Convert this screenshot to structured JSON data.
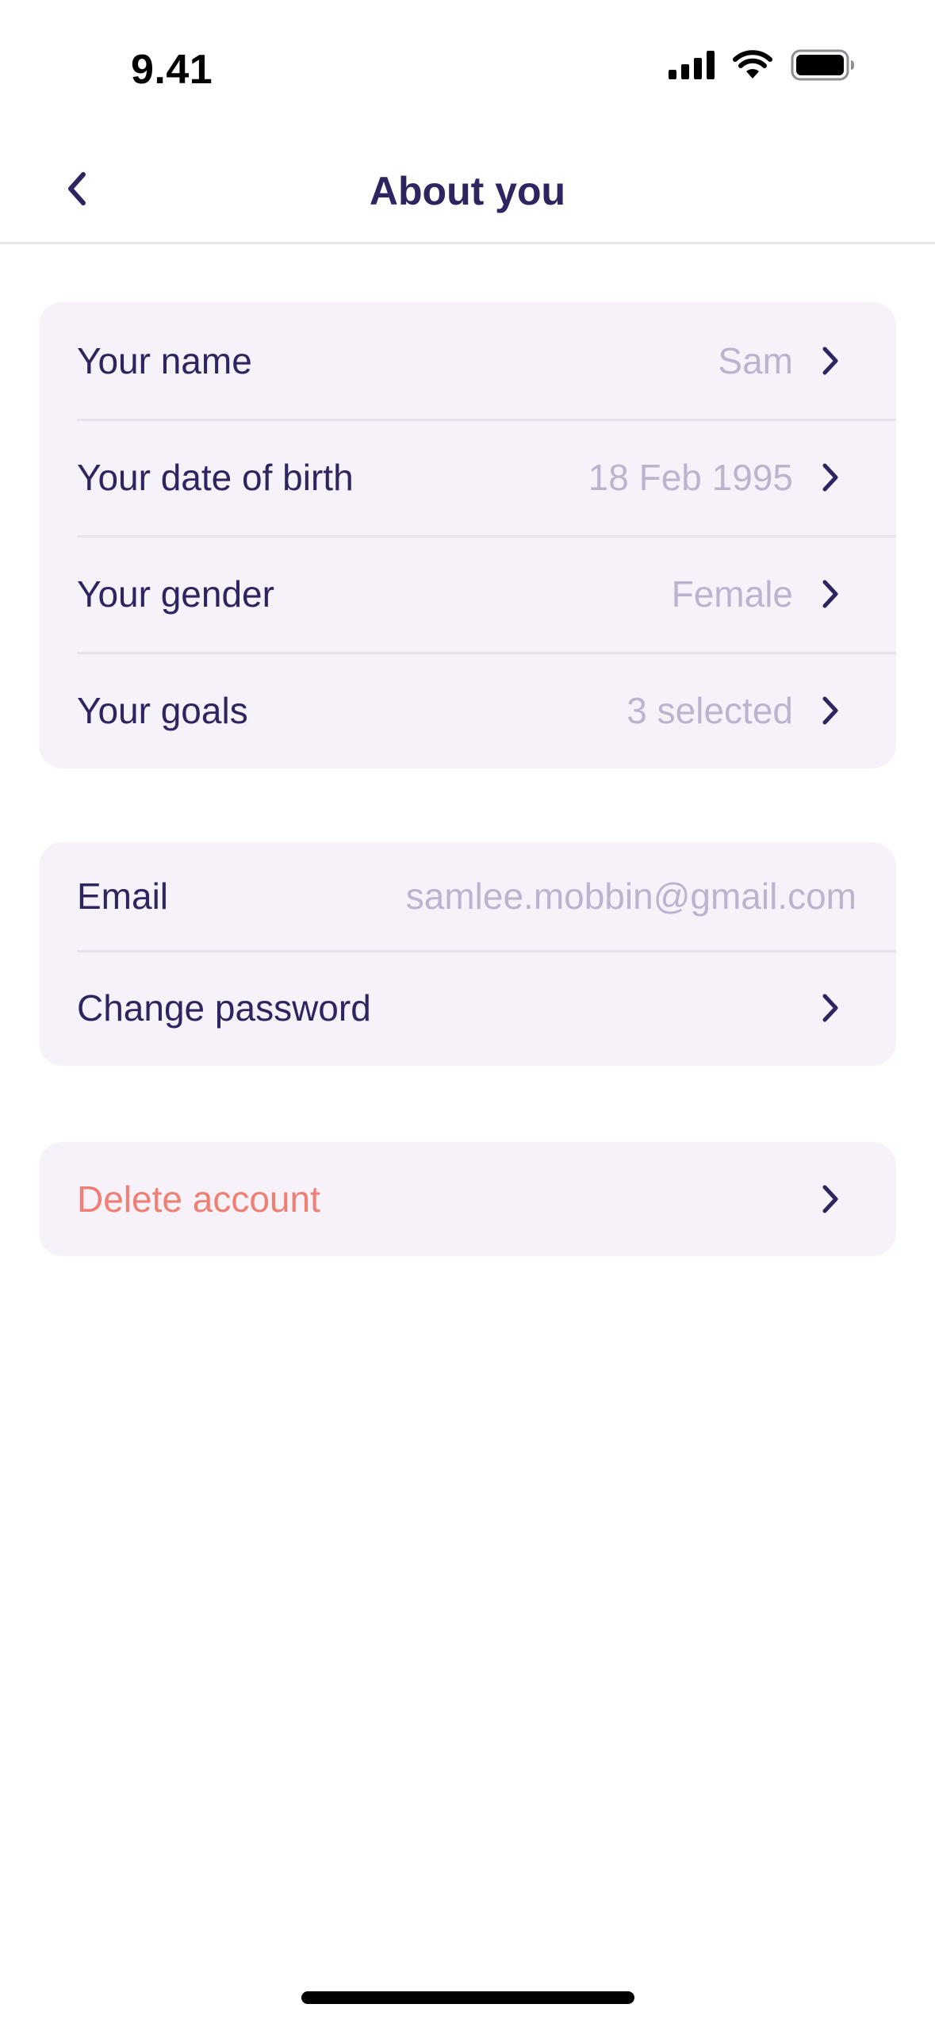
{
  "status_bar": {
    "time": "9.41",
    "icons": [
      "signal-icon",
      "wifi-icon",
      "battery-icon"
    ]
  },
  "nav": {
    "title": "About you",
    "back_icon": "chevron-left-icon"
  },
  "profile_section": [
    {
      "label": "Your name",
      "value": "Sam"
    },
    {
      "label": "Your date of birth",
      "value": "18 Feb 1995"
    },
    {
      "label": "Your gender",
      "value": "Female"
    },
    {
      "label": "Your goals",
      "value": "3 selected"
    }
  ],
  "account_section": {
    "email_label": "Email",
    "email_value": "samlee.mobbin@gmail.com",
    "password_label": "Change password"
  },
  "danger_section": {
    "delete_label": "Delete account"
  },
  "colors": {
    "primary_text": "#2d2460",
    "muted_value": "#bdb3cf",
    "card_background": "#f7f2fa",
    "danger": "#f07f73",
    "divider": "#e6e1ec"
  }
}
